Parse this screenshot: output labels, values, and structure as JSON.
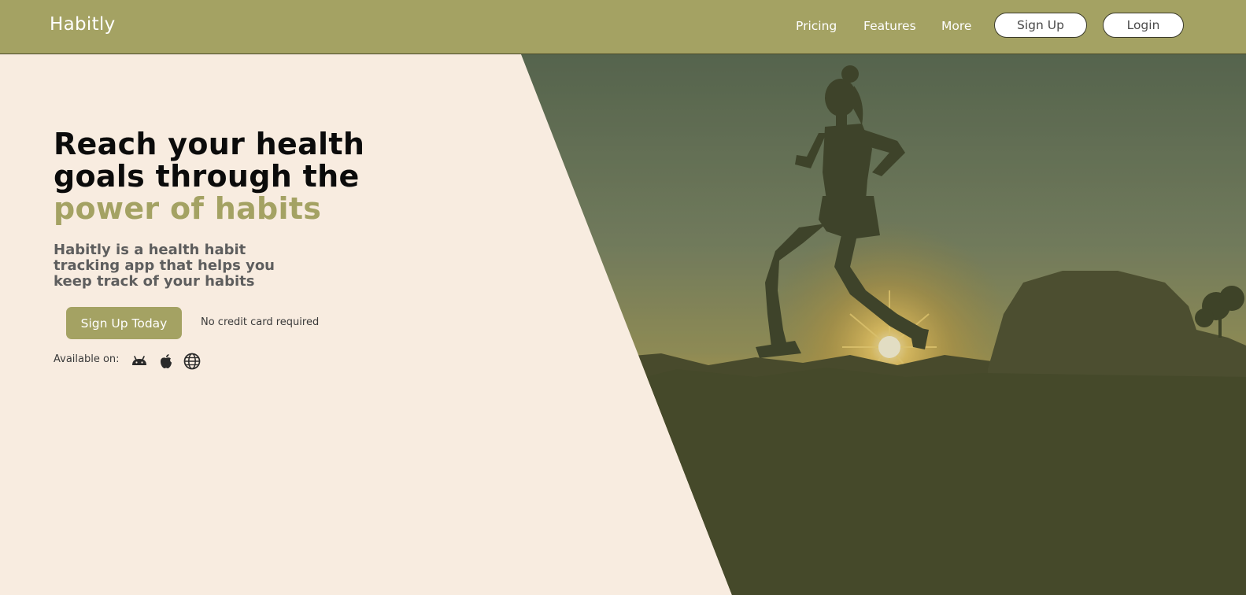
{
  "brand": {
    "name": "Habitly"
  },
  "nav": {
    "links": [
      "Pricing",
      "Features",
      "More"
    ],
    "signup_label": "Sign Up",
    "login_label": "Login"
  },
  "hero": {
    "headline_lines": [
      "Reach your health",
      "goals through the"
    ],
    "headline_accent": "power of habits",
    "sub_lines": [
      "Habitly is a health habit",
      "tracking app that helps you",
      "keep track of your habits"
    ],
    "cta_label": "Sign Up Today",
    "cta_note": "No credit card required",
    "available_label": "Available on:",
    "platform_icons": [
      "android-icon",
      "apple-icon",
      "globe-icon"
    ],
    "image_subject": "runner-silhouette-at-sunset"
  },
  "colors": {
    "accent": "#a4a263",
    "background": "#f8ece0",
    "headline": "#0b0b0b",
    "subtext": "#5e5e5e"
  }
}
